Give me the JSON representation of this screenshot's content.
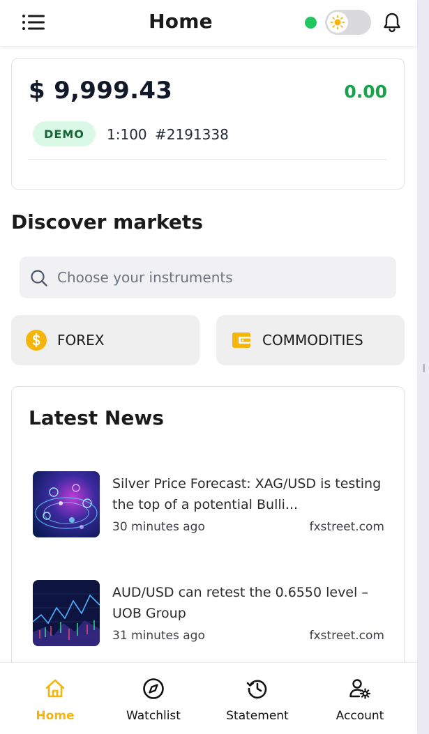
{
  "header": {
    "title": "Home",
    "status_color": "#22c55e",
    "theme_icon": "sun-icon",
    "menu_icon": "hamburger-menu-icon",
    "notification_icon": "bell-icon"
  },
  "account": {
    "balance": "$ 9,999.43",
    "pnl": "0.00",
    "mode_badge": "DEMO",
    "leverage": "1:100",
    "account_number": "#2191338"
  },
  "discover": {
    "title": "Discover markets",
    "search_placeholder": "Choose your instruments",
    "search_value": "",
    "categories": [
      {
        "label": "FOREX",
        "icon": "dollar-coin-icon"
      },
      {
        "label": "COMMODITIES",
        "icon": "wallet-icon"
      }
    ]
  },
  "news": {
    "title": "Latest News",
    "items": [
      {
        "headline": "Silver Price Forecast: XAG/USD is testing the top of a potential Bulli...",
        "time": "30 minutes ago",
        "source": "fxstreet.com"
      },
      {
        "headline": "AUD/USD can retest the 0.6550 level – UOB Group",
        "time": "31 minutes ago",
        "source": "fxstreet.com"
      }
    ]
  },
  "bottom_nav": {
    "items": [
      {
        "label": "Home",
        "icon": "home-icon",
        "active": true
      },
      {
        "label": "Watchlist",
        "icon": "compass-icon",
        "active": false
      },
      {
        "label": "Statement",
        "icon": "history-icon",
        "active": false
      },
      {
        "label": "Account",
        "icon": "user-settings-icon",
        "active": false
      }
    ],
    "active_color": "#f5b50a"
  }
}
